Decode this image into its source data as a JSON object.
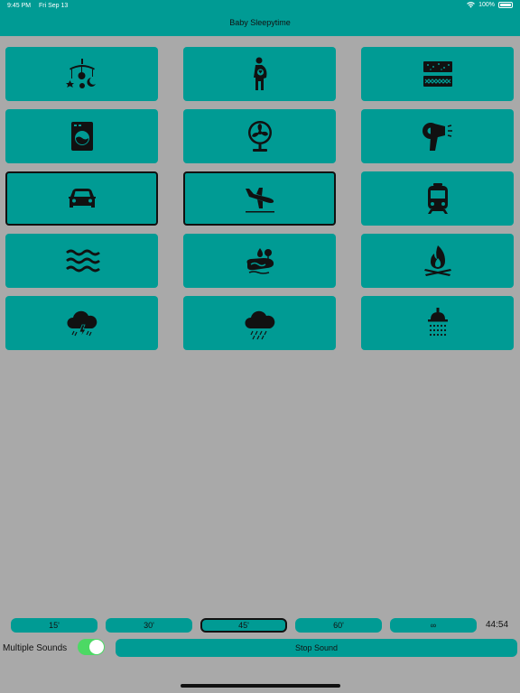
{
  "status_bar": {
    "time": "9:45 PM",
    "date": "Fri Sep 13",
    "battery": "100%"
  },
  "app": {
    "title": "Baby Sleepytime"
  },
  "sounds": [
    {
      "icon": "baby-mobile-icon"
    },
    {
      "icon": "pregnant-mother-icon"
    },
    {
      "icon": "fabric-noise-icon"
    },
    {
      "icon": "washing-machine-icon"
    },
    {
      "icon": "fan-icon"
    },
    {
      "icon": "hair-dryer-icon"
    },
    {
      "icon": "car-icon",
      "selected": true
    },
    {
      "icon": "airplane-icon",
      "selected": true
    },
    {
      "icon": "train-icon"
    },
    {
      "icon": "ocean-waves-icon"
    },
    {
      "icon": "stream-icon"
    },
    {
      "icon": "campfire-icon"
    },
    {
      "icon": "thunderstorm-icon"
    },
    {
      "icon": "rain-icon"
    },
    {
      "icon": "shower-icon"
    }
  ],
  "timer": {
    "options": [
      "15'",
      "30'",
      "45'",
      "60'",
      "∞"
    ],
    "selected": "45'",
    "remaining": "44:54"
  },
  "footer": {
    "multiple_sounds_label": "Multiple Sounds",
    "multiple_sounds_on": true,
    "stop_label": "Stop Sound"
  },
  "colors": {
    "accent": "#009b94",
    "background": "#a9a9a9",
    "toggle_on": "#4cd964"
  }
}
